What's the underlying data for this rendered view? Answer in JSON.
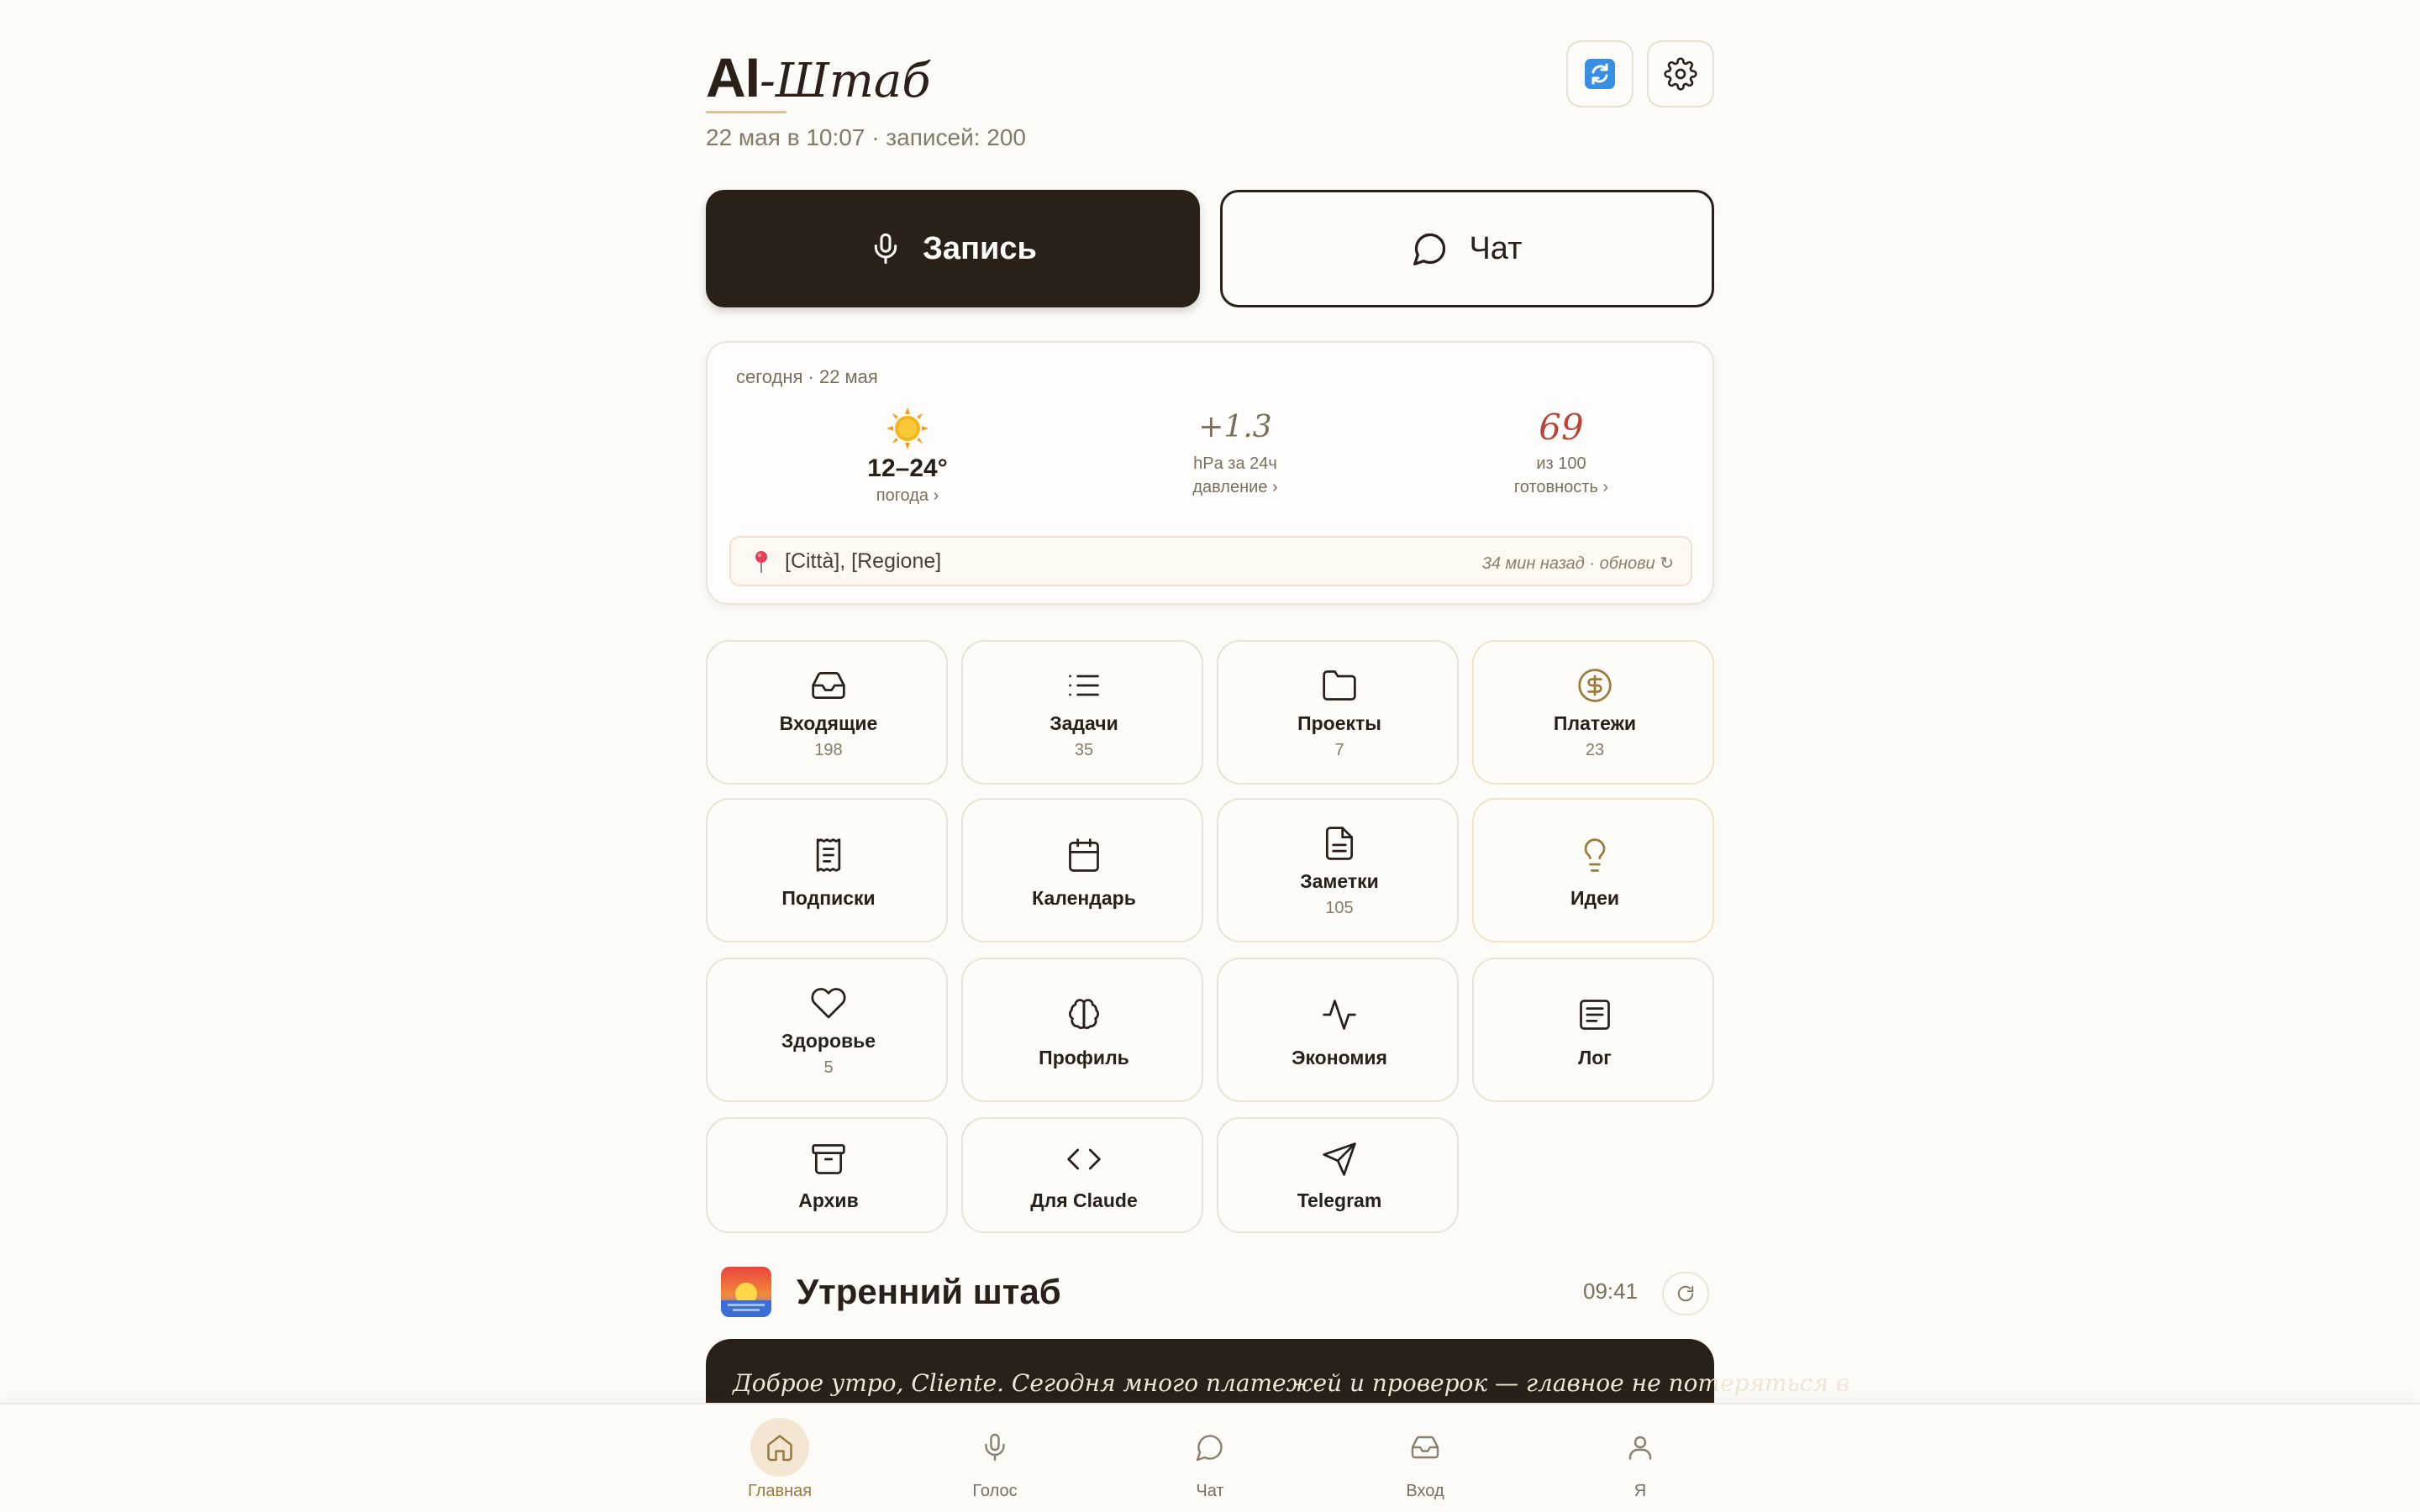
{
  "header": {
    "brand_ai": "AI",
    "brand_rest": "-Штаб",
    "subtitle": "22 мая в 10:07 · записей: 200"
  },
  "actions": {
    "record_label": "Запись",
    "chat_label": "Чат"
  },
  "today": {
    "label": "сегодня · 22 мая",
    "weather": {
      "value": "12–24°",
      "link": "погода ›",
      "icon": "sun-icon"
    },
    "pressure": {
      "value": "+1.3",
      "unit": "hPa за 24ч",
      "link": "давление ›"
    },
    "readiness": {
      "value": "69",
      "unit": "из 100",
      "link": "готовность ›"
    },
    "location": "[Città], [Regione]",
    "location_updated": "34 мин назад · обнови ↻"
  },
  "tiles": [
    {
      "label": "Входящие",
      "count": "198",
      "icon": "inbox-icon"
    },
    {
      "label": "Задачи",
      "count": "35",
      "icon": "list-icon"
    },
    {
      "label": "Проекты",
      "count": "7",
      "icon": "folder-icon"
    },
    {
      "label": "Платежи",
      "count": "23",
      "icon": "dollar-icon"
    },
    {
      "label": "Подписки",
      "count": "",
      "icon": "receipt-icon"
    },
    {
      "label": "Календарь",
      "count": "",
      "icon": "calendar-icon"
    },
    {
      "label": "Заметки",
      "count": "105",
      "icon": "note-icon"
    },
    {
      "label": "Идеи",
      "count": "",
      "icon": "lightbulb-icon"
    },
    {
      "label": "Здоровье",
      "count": "5",
      "icon": "heart-icon"
    },
    {
      "label": "Профиль",
      "count": "",
      "icon": "brain-icon"
    },
    {
      "label": "Экономия",
      "count": "",
      "icon": "activity-icon"
    },
    {
      "label": "Лог",
      "count": "",
      "icon": "log-icon"
    },
    {
      "label": "Архив",
      "count": "",
      "icon": "archive-icon"
    },
    {
      "label": "Для Claude",
      "count": "",
      "icon": "code-icon"
    },
    {
      "label": "Telegram",
      "count": "",
      "icon": "send-icon"
    }
  ],
  "morning": {
    "title": "Утренний штаб",
    "time": "09:41",
    "text": "Доброе утро, Cliente. Сегодня много платежей и проверок — главное не потеряться в"
  },
  "nav": [
    {
      "label": "Главная",
      "icon": "home-icon",
      "active": true
    },
    {
      "label": "Голос",
      "icon": "mic-icon",
      "active": false
    },
    {
      "label": "Чат",
      "icon": "chat-icon",
      "active": false
    },
    {
      "label": "Вход",
      "icon": "inbox-icon",
      "active": false
    },
    {
      "label": "Я",
      "icon": "user-icon",
      "active": false
    }
  ],
  "colors": {
    "background": "#fcfbf8",
    "dark": "#2a201a",
    "accent_gold": "#9a7a3e",
    "readiness_red": "#b5473d"
  }
}
